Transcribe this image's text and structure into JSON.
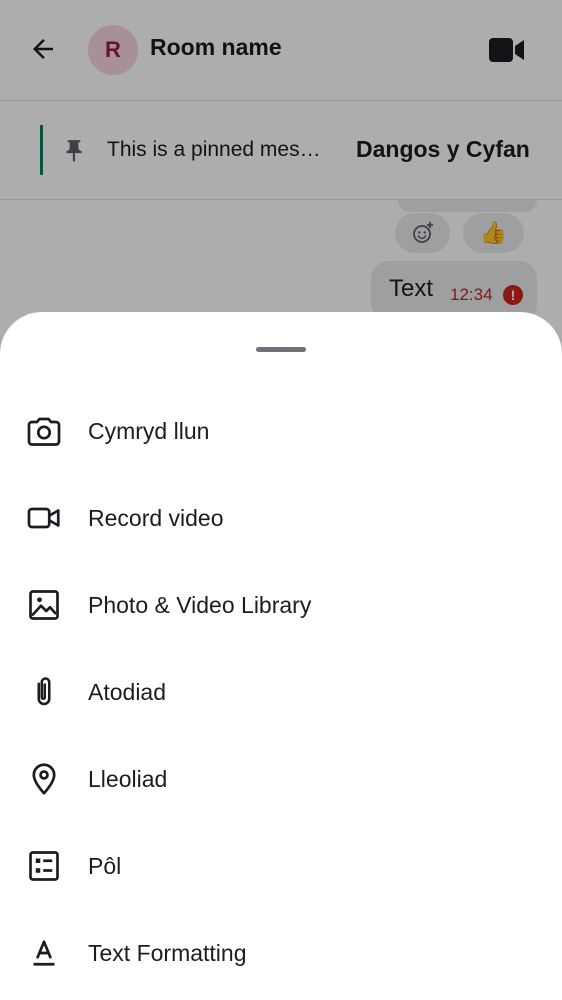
{
  "header": {
    "back_icon": "arrow-left-icon",
    "avatar_letter": "R",
    "room_name": "Room name",
    "video_icon": "video-call-icon"
  },
  "pinned": {
    "icon": "pin-icon",
    "message": "This is a pinned mes…",
    "action": "Dangos y Cyfan"
  },
  "timeline": {
    "reactions": [
      {
        "icon": "add-reaction-icon"
      },
      {
        "emoji": "👍"
      }
    ],
    "message": {
      "text": "Text",
      "time": "12:34",
      "status_icon": "error-icon"
    }
  },
  "sheet": {
    "items": [
      {
        "label": "Cymryd llun",
        "icon": "camera-icon"
      },
      {
        "label": "Record video",
        "icon": "video-icon"
      },
      {
        "label": "Photo & Video Library",
        "icon": "image-icon"
      },
      {
        "label": "Atodiad",
        "icon": "paperclip-icon"
      },
      {
        "label": "Lleoliad",
        "icon": "location-pin-icon"
      },
      {
        "label": "Pôl",
        "icon": "poll-icon"
      },
      {
        "label": "Text Formatting",
        "icon": "text-format-icon"
      }
    ]
  },
  "colors": {
    "accent": "#0d7a5f",
    "error": "#d1221a",
    "avatar_bg": "#f7d4e0",
    "avatar_fg": "#9b1c4a"
  }
}
